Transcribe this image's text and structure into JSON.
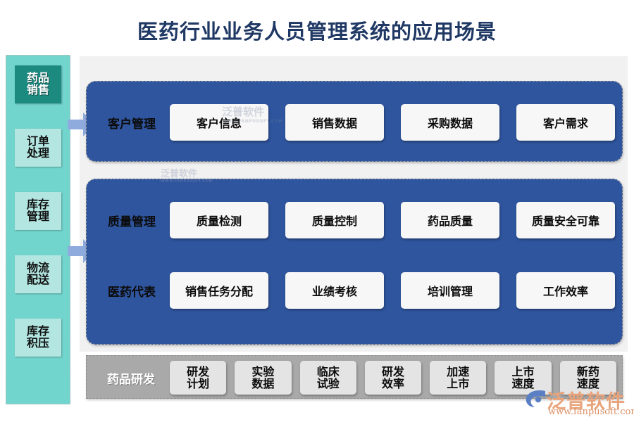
{
  "title": "医药行业业务人员管理系统的应用场景",
  "colors": {
    "title": "#1F3864",
    "panel_blue": "#2F559E",
    "sidebar_bg": "#72D5CD",
    "sidebar_active": "#1D8A80",
    "sidebar_item": "#B3E6E1",
    "arrow": "#8FAADC",
    "rnd_bar": "#A9A9A9",
    "rnd_card": "#E4E4E4",
    "canvas": "#F1F1F1",
    "card": "#F7F7F7",
    "brand": "#E8A37A"
  },
  "sidebar": {
    "items": [
      {
        "label": "药品销售",
        "line1": "药品",
        "line2": "销售",
        "active": true
      },
      {
        "label": "订单处理",
        "line1": "订单",
        "line2": "处理",
        "active": false
      },
      {
        "label": "库存管理",
        "line1": "库存",
        "line2": "管理",
        "active": false
      },
      {
        "label": "物流配送",
        "line1": "物流",
        "line2": "配送",
        "active": false
      },
      {
        "label": "库存积压",
        "line1": "库存",
        "line2": "积压",
        "active": false
      }
    ]
  },
  "arrows": [
    {
      "name": "arrow-to-customer-panel",
      "direction": "right"
    },
    {
      "name": "arrow-to-quality-panel",
      "direction": "right"
    }
  ],
  "panels": [
    {
      "id": "customer",
      "rows": [
        {
          "label": "客户管理",
          "cards": [
            "客户信息",
            "销售数据",
            "采购数据",
            "客户需求"
          ]
        }
      ]
    },
    {
      "id": "quality",
      "rows": [
        {
          "label": "质量管理",
          "cards": [
            "质量检测",
            "质量控制",
            "药品质量",
            "质量安全可靠"
          ]
        },
        {
          "label": "医药代表",
          "cards": [
            "销售任务分配",
            "业绩考核",
            "培训管理",
            "工作效率"
          ]
        }
      ]
    }
  ],
  "rnd": {
    "label": "药品研发",
    "cards": [
      {
        "line1": "研发",
        "line2": "计划"
      },
      {
        "line1": "实验",
        "line2": "数据"
      },
      {
        "line1": "临床",
        "line2": "试验"
      },
      {
        "line1": "研发",
        "line2": "效率"
      },
      {
        "line1": "加速",
        "line2": "上市"
      },
      {
        "line1": "上市",
        "line2": "速度"
      },
      {
        "line1": "新药",
        "line2": "速度"
      }
    ]
  },
  "watermarks": {
    "faint_name": "泛普软件",
    "faint_url": "WWW.FANPUSOFT.COM"
  },
  "brand": {
    "name": "泛普软件",
    "url": "www.fanpusoft.com"
  }
}
